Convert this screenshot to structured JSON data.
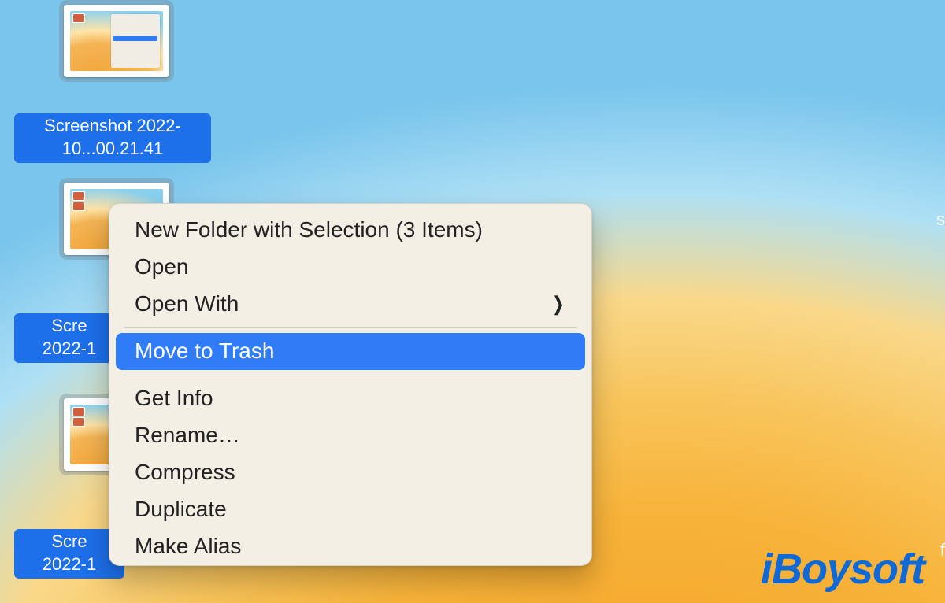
{
  "desktop_icons": [
    {
      "id": "icon1",
      "label": "Screenshot 2022-10...00.21.41"
    },
    {
      "id": "icon2",
      "label": "Scre\n2022-1"
    },
    {
      "id": "icon3",
      "label": "Scre\n2022-1"
    }
  ],
  "context_menu": {
    "items": [
      {
        "label": "New Folder with Selection (3 Items)",
        "kind": "item"
      },
      {
        "label": "Open",
        "kind": "item"
      },
      {
        "label": "Open With",
        "kind": "submenu"
      },
      {
        "kind": "separator"
      },
      {
        "label": "Move to Trash",
        "kind": "item",
        "highlighted": true
      },
      {
        "kind": "separator"
      },
      {
        "label": "Get Info",
        "kind": "item"
      },
      {
        "label": "Rename…",
        "kind": "item"
      },
      {
        "label": "Compress",
        "kind": "item"
      },
      {
        "label": "Duplicate",
        "kind": "item"
      },
      {
        "label": "Make Alias",
        "kind": "item"
      }
    ]
  },
  "watermark": "iBoysoft",
  "edge": {
    "top": "s",
    "bottom": "f"
  }
}
